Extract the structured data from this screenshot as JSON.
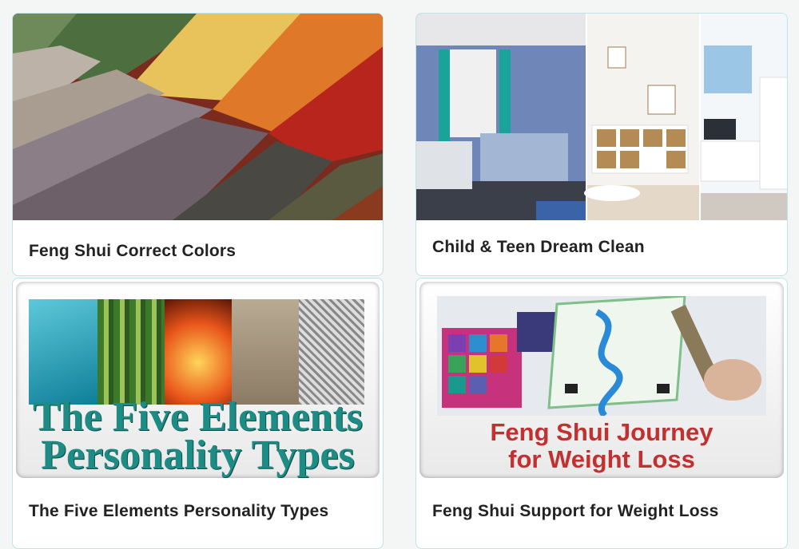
{
  "cards": [
    {
      "title": "Feng Shui Correct Colors",
      "image_label": "fabric-swatches"
    },
    {
      "title": "Child & Teen Dream Clean",
      "image_label": "bedroom-collage"
    },
    {
      "title": "The Five Elements Personality Types",
      "image_text_line1": "The Five Elements",
      "image_text_line2": "Personality Types"
    },
    {
      "title": "Feng Shui Support for Weight Loss",
      "image_text_line1": "Feng Shui Journey",
      "image_text_line2": "for Weight Loss"
    }
  ],
  "colors": {
    "accent_border": "#bfe3e6",
    "title_text": "#222222",
    "elements_text": "#1d8c84",
    "journey_text": "#c23030"
  }
}
